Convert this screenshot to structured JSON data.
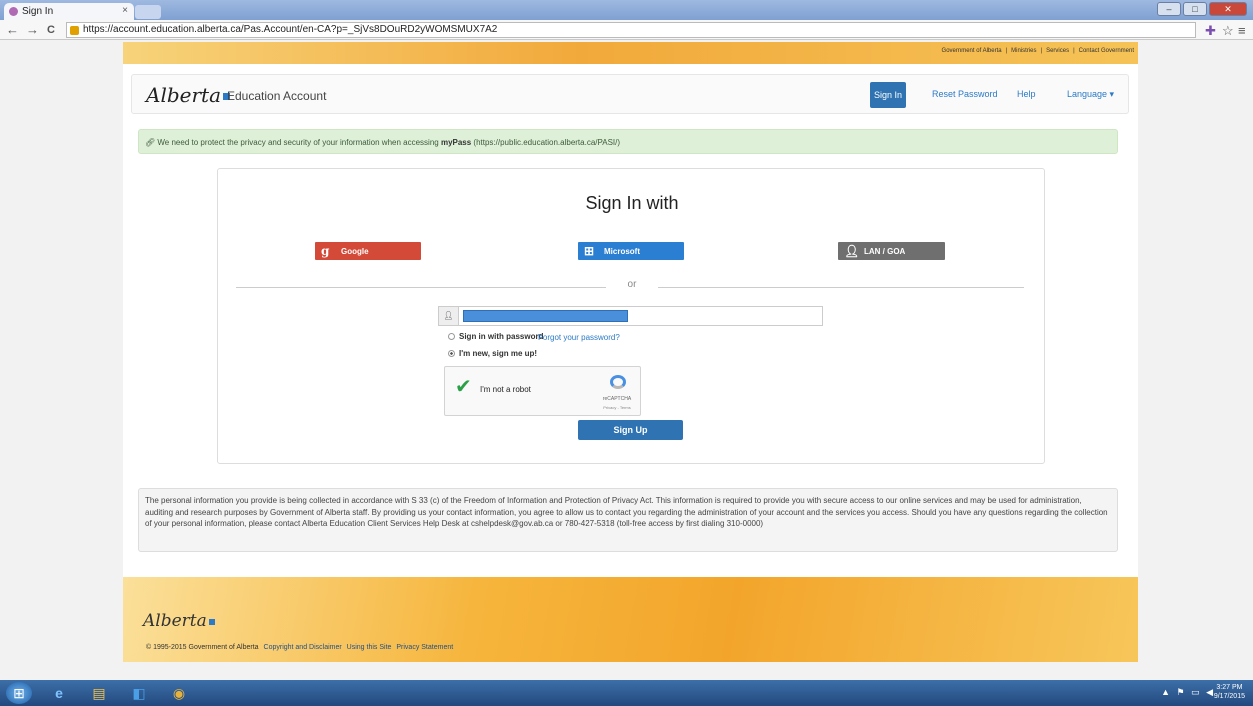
{
  "browser": {
    "tab_title": "Sign In",
    "tab_close": "×",
    "url": "https://account.education.alberta.ca/Pas.Account/en-CA?p=_SjVs8DOuRD2yWOMSMUX7A2",
    "back": "←",
    "forward": "→",
    "reload": "C",
    "menu": "≡",
    "star": "☆"
  },
  "gov_links": [
    "Government of Alberta",
    "Ministries",
    "Services",
    "Contact Government"
  ],
  "gov_sep": "|",
  "header": {
    "logo": "Alberta",
    "app_name": "Education Account",
    "sign_in": "Sign In",
    "reset_password": "Reset Password",
    "help": "Help",
    "language": "Language ▾"
  },
  "alert": {
    "prefix": "We need to protect the privacy and security of your information when accessing ",
    "app": "myPass",
    "suffix": " (https://public.education.alberta.ca/PASI/)"
  },
  "signin": {
    "title": "Sign In with",
    "providers": {
      "google": "Google",
      "microsoft": "Microsoft",
      "lan": "LAN / GOA"
    },
    "or": "or",
    "radio_password": "Sign in with password",
    "forgot": "Forgot your password?",
    "radio_new": "I'm new, sign me up!",
    "captcha_label": "I'm not a robot",
    "captcha_brand": "reCAPTCHA",
    "captcha_links": "Privacy - Terms",
    "sign_up": "Sign Up"
  },
  "privacy_text": "The personal information you provide is being collected in accordance with S 33 (c) of the Freedom of Information and Protection of Privacy Act. This information is required to provide you with secure access to our online services and may be used for administration, auditing and research purposes by Government of Alberta staff. By providing us your contact information, you agree to allow us to contact you regarding the administration of your account and the services you access. Should you have any questions regarding the collection of your personal information, please contact Alberta Education Client Services Help Desk at cshelpdesk@gov.ab.ca or 780-427-5318 (toll-free access by first dialing 310-0000)",
  "footer": {
    "logo": "Alberta",
    "copyright": "© 1995-2015 Government of Alberta",
    "links": [
      "Copyright and Disclaimer",
      "Using this Site",
      "Privacy Statement"
    ]
  },
  "taskbar": {
    "time": "3:27 PM",
    "date": "9/17/2015"
  },
  "colors": {
    "primary": "#2f73b3",
    "google": "#d44a38",
    "microsoft": "#2b7fd2",
    "lan": "#6f6f6f",
    "alert_bg": "#dff0d8"
  }
}
